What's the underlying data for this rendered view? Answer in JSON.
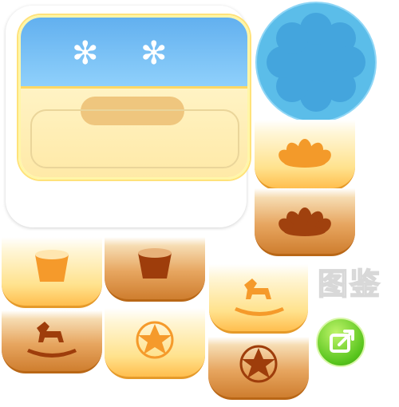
{
  "panel": {
    "title": "",
    "colors": {
      "header": "#6cb9f2",
      "body": "#fff0bb"
    }
  },
  "label": {
    "text": "图鉴"
  },
  "tabs": [
    {
      "icon": "lotus-icon",
      "variant": "light"
    },
    {
      "icon": "lotus-icon",
      "variant": "dark"
    },
    {
      "icon": "bucket-icon",
      "variant": "light"
    },
    {
      "icon": "bucket-icon",
      "variant": "dark"
    },
    {
      "icon": "rocking-horse-icon",
      "variant": "light"
    },
    {
      "icon": "rocking-horse-icon",
      "variant": "dark"
    },
    {
      "icon": "star-icon",
      "variant": "light"
    },
    {
      "icon": "star-icon",
      "variant": "dark"
    }
  ],
  "buttons": {
    "share_icon": "share-icon"
  }
}
